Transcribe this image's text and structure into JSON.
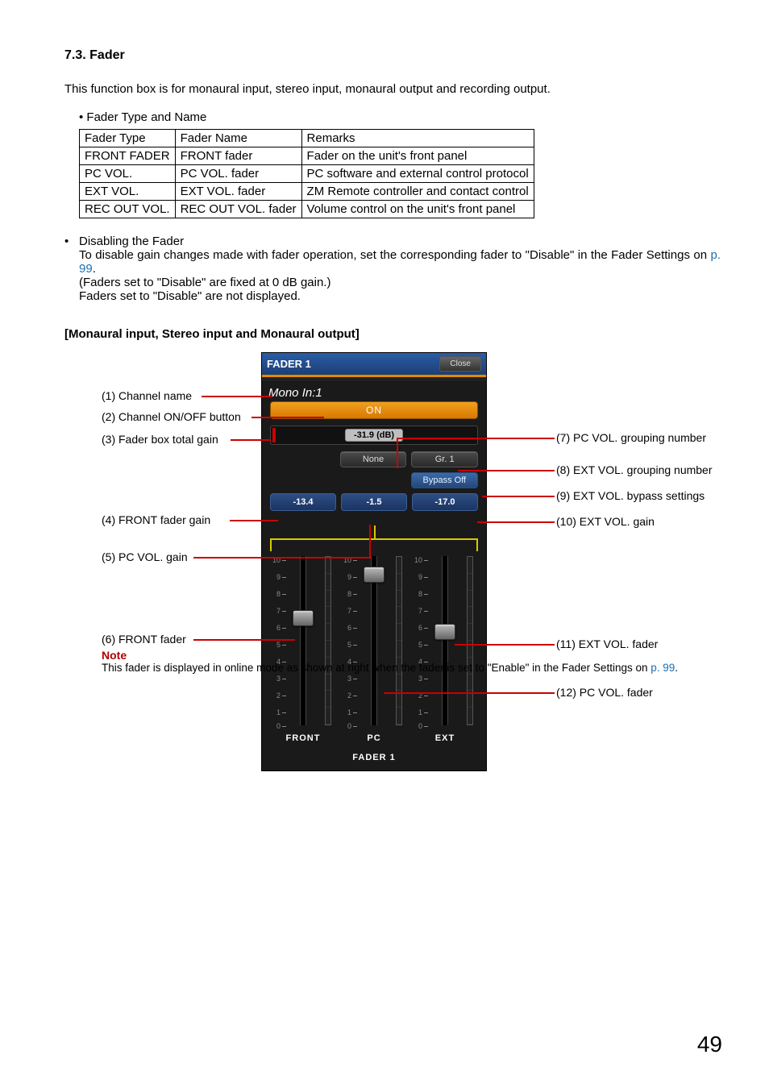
{
  "section": {
    "number": "7.3.",
    "title": "Fader"
  },
  "intro": "This function box is for monaural input, stereo input, monaural output and recording output.",
  "table_caption": "Fader Type and Name",
  "table": {
    "headers": [
      "Fader Type",
      "Fader Name",
      "Remarks"
    ],
    "rows": [
      [
        "FRONT FADER",
        "FRONT fader",
        "Fader on the unit's front panel"
      ],
      [
        "PC VOL.",
        "PC VOL. fader",
        "PC software and external control protocol"
      ],
      [
        "EXT VOL.",
        "EXT VOL. fader",
        "ZM Remote controller and contact control"
      ],
      [
        "REC OUT VOL.",
        "REC OUT VOL. fader",
        "Volume control on the unit's front panel"
      ]
    ]
  },
  "disable": {
    "heading": "Disabling the Fader",
    "line1a": "To disable gain changes made with fader operation, set the corresponding fader to \"Disable\" in the Fader Settings on ",
    "link1": "p. 99",
    "line1b": ".",
    "line2": "(Faders set to \"Disable\" are fixed at 0 dB gain.)",
    "line3": "Faders set to \"Disable\" are not displayed."
  },
  "sub_heading": "[Monaural input, Stereo input and Monaural output]",
  "callouts": {
    "c1": "(1) Channel name",
    "c2": "(2) Channel ON/OFF button",
    "c3": "(3) Fader box total gain",
    "c4": "(4) FRONT fader gain",
    "c5": "(5) PC VOL. gain",
    "c6": "(6) FRONT fader",
    "c7": "(7) PC VOL. grouping number",
    "c8": "(8) EXT VOL. grouping number",
    "c9": "(9) EXT VOL. bypass settings",
    "c10": "(10) EXT VOL. gain",
    "c11": "(11) EXT VOL. fader",
    "c12": "(12) PC VOL. fader"
  },
  "note": {
    "title": "Note",
    "body_a": "This fader is displayed in online mode as shown at right when the fader is set to \"Enable\" in the Fader Settings on ",
    "link": "p. 99",
    "body_b": "."
  },
  "ui": {
    "title": "FADER 1",
    "close": "Close",
    "channel_name": "Mono In:1",
    "on_label": "ON",
    "total_gain": "-31.9 (dB)",
    "group_pc": "None",
    "group_ext": "Gr. 1",
    "bypass": "Bypass Off",
    "gain_front": "-13.4",
    "gain_pc": "-1.5",
    "gain_ext": "-17.0",
    "col_front": "FRONT",
    "col_pc": "PC",
    "col_ext": "EXT",
    "footer": "FADER 1",
    "scale": [
      "10",
      "9",
      "8",
      "7",
      "6",
      "5",
      "4",
      "3",
      "2",
      "1",
      "0"
    ]
  },
  "page": "49"
}
